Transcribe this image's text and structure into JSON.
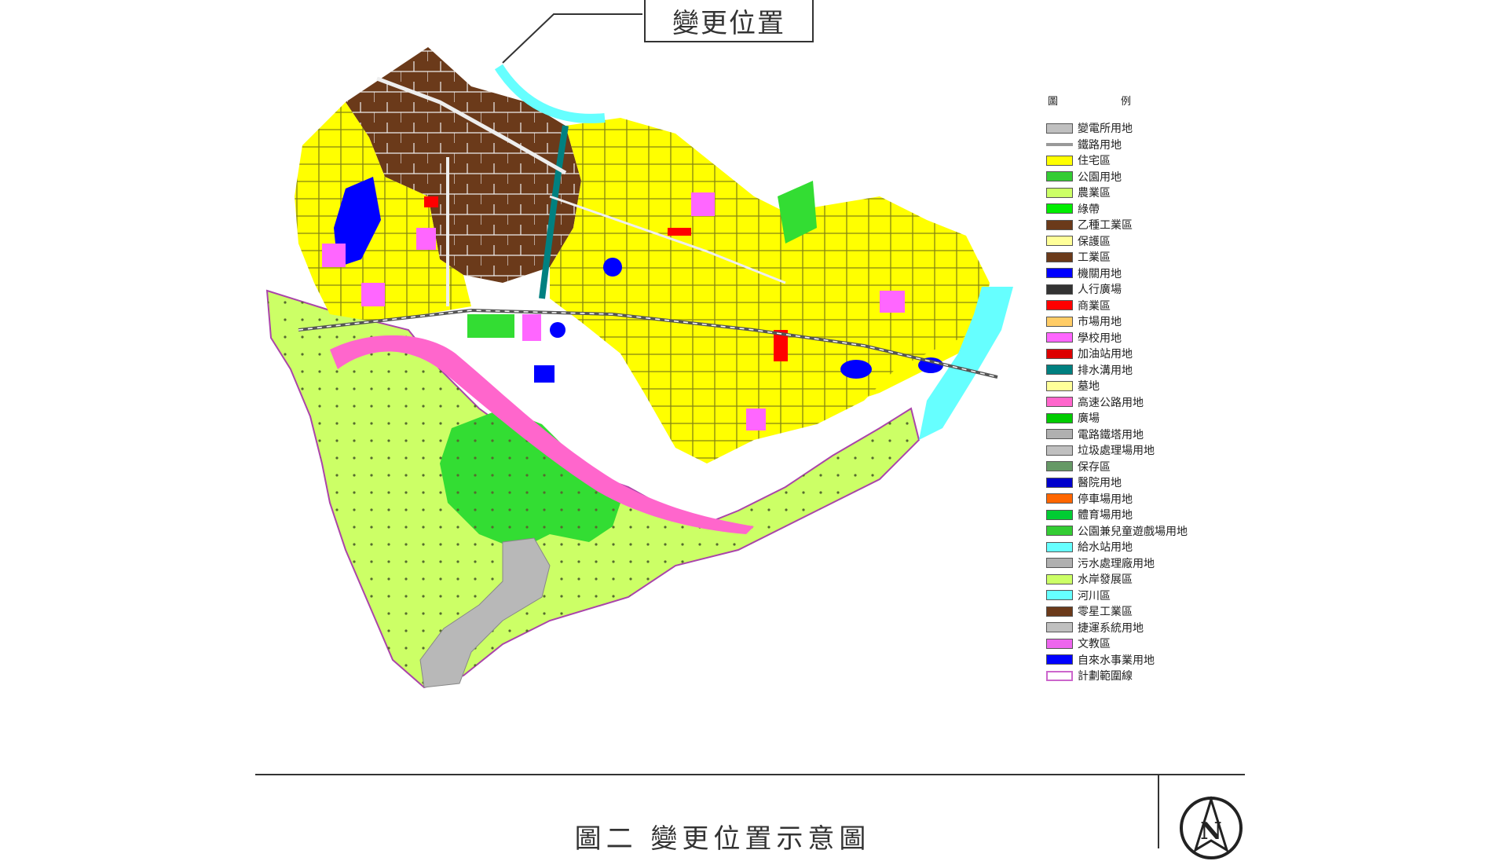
{
  "callout": {
    "label": "變更位置"
  },
  "legend": {
    "headers": [
      "圖",
      "例"
    ],
    "items": [
      {
        "label": "變電所用地",
        "color": "#c0c0c0"
      },
      {
        "label": "鐵路用地",
        "color": "#999999",
        "style": "line"
      },
      {
        "label": "住宅區",
        "color": "#ffff00"
      },
      {
        "label": "公園用地",
        "color": "#33cc33"
      },
      {
        "label": "農業區",
        "color": "#ccff66"
      },
      {
        "label": "綠帶",
        "color": "#00ee00"
      },
      {
        "label": "乙種工業區",
        "color": "#6b3a1a"
      },
      {
        "label": "保護區",
        "color": "#ffff99"
      },
      {
        "label": "工業區",
        "color": "#6b3a1a"
      },
      {
        "label": "機關用地",
        "color": "#0000ff"
      },
      {
        "label": "人行廣場",
        "color": "#333333"
      },
      {
        "label": "商業區",
        "color": "#ff0000"
      },
      {
        "label": "市場用地",
        "color": "#ffcc66"
      },
      {
        "label": "學校用地",
        "color": "#ff66ff"
      },
      {
        "label": "加油站用地",
        "color": "#dd0000"
      },
      {
        "label": "排水溝用地",
        "color": "#008080"
      },
      {
        "label": "墓地",
        "color": "#ffff99"
      },
      {
        "label": "高速公路用地",
        "color": "#ff66cc"
      },
      {
        "label": "廣場",
        "color": "#00cc00"
      },
      {
        "label": "電路鐵塔用地",
        "color": "#b0b0b0"
      },
      {
        "label": "垃圾處理場用地",
        "color": "#c0c0c0"
      },
      {
        "label": "保存區",
        "color": "#669966"
      },
      {
        "label": "醫院用地",
        "color": "#0000cc"
      },
      {
        "label": "停車場用地",
        "color": "#ff6600"
      },
      {
        "label": "體育場用地",
        "color": "#00cc33"
      },
      {
        "label": "公園兼兒童遊戲場用地",
        "color": "#33cc33"
      },
      {
        "label": "給水站用地",
        "color": "#66ffff"
      },
      {
        "label": "污水處理廠用地",
        "color": "#b0b0b0"
      },
      {
        "label": "水岸發展區",
        "color": "#ccff66"
      },
      {
        "label": "河川區",
        "color": "#66ffff"
      },
      {
        "label": "零星工業區",
        "color": "#6b3a1a"
      },
      {
        "label": "捷運系統用地",
        "color": "#c0c0c0"
      },
      {
        "label": "文教區",
        "color": "#ee66ee"
      },
      {
        "label": "自來水事業用地",
        "color": "#0000ff"
      },
      {
        "label": "計劃範圍線",
        "color": "#cc66cc",
        "style": "boundary"
      }
    ]
  },
  "caption": "圖二  變更位置示意圖",
  "north_arrow": {
    "letter": "N"
  },
  "colors": {
    "residential": "#ffff00",
    "industrial": "#6b3a1a",
    "agricultural": "#ccff66",
    "park": "#33cc33",
    "highway": "#ff66cc",
    "river": "#66ffff",
    "government": "#0000ff",
    "school": "#ff66ff",
    "commercial": "#ff0000",
    "grey": "#b8b8b8"
  }
}
